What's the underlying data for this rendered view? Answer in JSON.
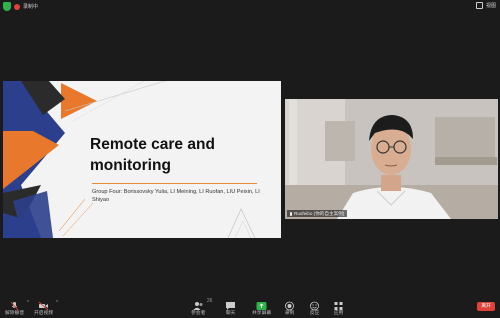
{
  "topbar": {
    "left_label": "录制中",
    "right_label": "视图",
    "colors": {
      "shield": "#2fb14a",
      "rec": "#e0423a"
    }
  },
  "slide": {
    "title": "Remote care and monitoring",
    "subtitle": "Group Four: Borissovsky Yulia, LI Meining, LI Ruofan, LIU Peixin, LI Shiyao",
    "colors": {
      "navy": "#2c3f8c",
      "orange": "#e8792c",
      "dark": "#2b2b2b",
      "bg": "#f3f3f3"
    }
  },
  "video": {
    "participant_name": "Ruofeibo (你的自主案例)"
  },
  "toolbar": {
    "mute_label": "解除静音",
    "video_label": "开启视频",
    "participants_label": "参会者",
    "participants_count": "26",
    "chat_label": "聊天",
    "share_label": "共享屏幕",
    "record_label": "录制",
    "reactions_label": "反应",
    "apps_label": "应用",
    "leave_label": "离开",
    "colors": {
      "share": "#2fb14a",
      "leave": "#e0423a"
    }
  }
}
